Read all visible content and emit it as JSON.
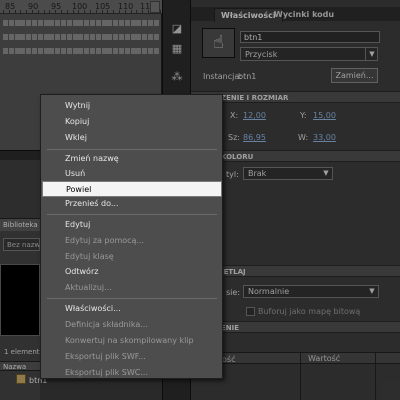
{
  "timeline": {
    "ruler_numbers": [
      "85",
      "90",
      "95",
      "100",
      "105",
      "110",
      "115"
    ]
  },
  "library": {
    "tab_label": "Biblioteka",
    "search_placeholder": "Bez nazwy",
    "item_count": "1 element",
    "column_name": "Nazwa",
    "items": [
      {
        "name": "btn1"
      }
    ]
  },
  "properties": {
    "tabs": [
      "Właściwości",
      "Wycinki kodu"
    ],
    "instance_name": "btn1",
    "symbol_type": "Przycisk",
    "instance_label": "Instancja:",
    "instance_value": "btn1",
    "swap_button": "Zamień...",
    "sections": {
      "position": "ZENIE I ROZMIAR",
      "color": "KOLORU",
      "display": "IETLAJ",
      "filters": "ENIE"
    },
    "x_label": "X:",
    "x_value": "12,00",
    "y_label": "Y:",
    "y_value": "15,00",
    "w_label": "Sz:",
    "w_value": "86,95",
    "h_label": "W:",
    "h_value": "33,00",
    "style_label": "tyl:",
    "style_value": "Brak",
    "blend_label": "sie:",
    "blend_value": "Normalnie",
    "bitmap_label": "Buforuj jako mapę bitową",
    "table_col1": "ość",
    "table_col2": "Wartość"
  },
  "context_menu": {
    "items": [
      {
        "label": "Wytnij",
        "enabled": true
      },
      {
        "label": "Kopiuj",
        "enabled": true
      },
      {
        "label": "Wklej",
        "enabled": true
      },
      {
        "label": "Zmień nazwę",
        "enabled": true
      },
      {
        "label": "Usuń",
        "enabled": true
      },
      {
        "label": "Powiel",
        "enabled": true,
        "highlighted": true
      },
      {
        "label": "Przenieś do...",
        "enabled": true
      },
      {
        "label": "Edytuj",
        "enabled": true
      },
      {
        "label": "Edytuj za pomocą...",
        "enabled": false
      },
      {
        "label": "Edytuj klasę",
        "enabled": false
      },
      {
        "label": "Odtwórz",
        "enabled": true
      },
      {
        "label": "Aktualizuj...",
        "enabled": false
      },
      {
        "label": "Właściwości...",
        "enabled": true
      },
      {
        "label": "Definicja składnika...",
        "enabled": false
      },
      {
        "label": "Konwertuj na skompilowany klip",
        "enabled": false
      },
      {
        "label": "Eksportuj plik SWF...",
        "enabled": false
      },
      {
        "label": "Eksportuj plik SWC...",
        "enabled": false
      }
    ]
  }
}
